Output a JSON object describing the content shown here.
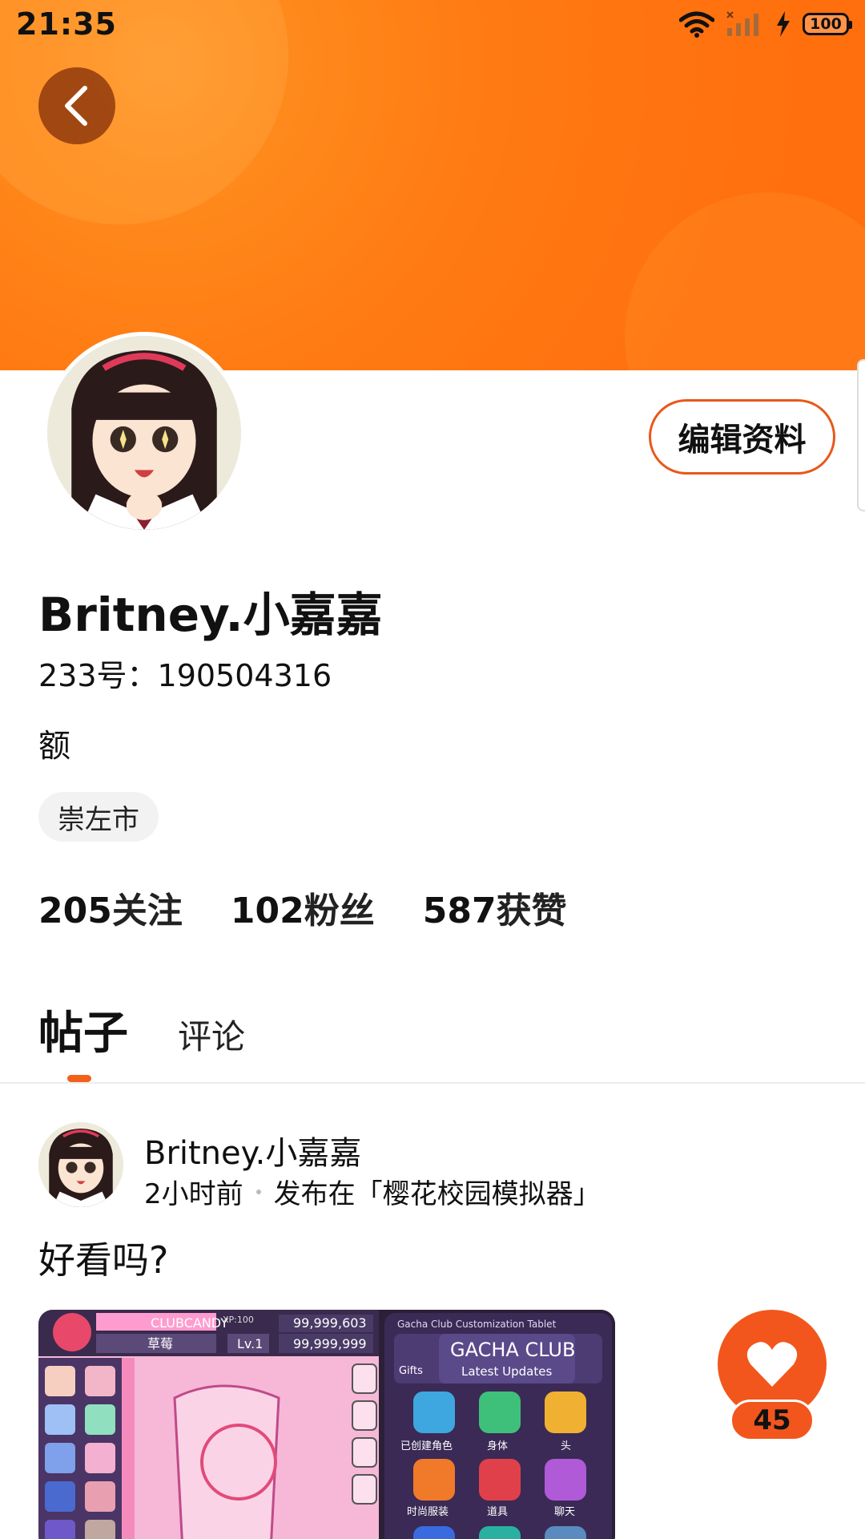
{
  "status_bar": {
    "time": "21:35",
    "battery": "100",
    "icons": [
      "wifi-icon",
      "signal-icon",
      "charging-icon",
      "battery-icon"
    ]
  },
  "header": {
    "back_icon": "chevron-left-icon",
    "banner_color": "#ff7a12"
  },
  "profile": {
    "username": "Britney.小嘉嘉",
    "user_id": "233号：190504316",
    "bio": "额",
    "location": "崇左市",
    "edit_button": "编辑资料",
    "stats": [
      {
        "number": "205",
        "label": "关注"
      },
      {
        "number": "102",
        "label": "粉丝"
      },
      {
        "number": "587",
        "label": "获赞"
      }
    ]
  },
  "tabs": [
    {
      "label": "帖子",
      "active": true
    },
    {
      "label": "评论",
      "active": false
    }
  ],
  "post": {
    "author": "Britney.小嘉嘉",
    "time": "2小时前",
    "published_in": "发布在「樱花校园模拟器」",
    "text": "好看吗?",
    "image_game": {
      "club_name": "CLUBCANDY",
      "xp": "XP:100",
      "level": "Lv.1",
      "name_tag": "草莓",
      "currency_a": "99,999,603",
      "currency_b": "99,999,999",
      "tablet_title": "Gacha Club Customization Tablet",
      "logo": "GACHA CLUB",
      "subtitle": "Latest Updates",
      "gifts": "Gifts",
      "menu": [
        "已创建角色",
        "身体",
        "头",
        "时尚服装",
        "道具",
        "聊天"
      ]
    }
  },
  "like": {
    "count": "45",
    "icon": "heart-icon",
    "accent": "#f2561c"
  }
}
